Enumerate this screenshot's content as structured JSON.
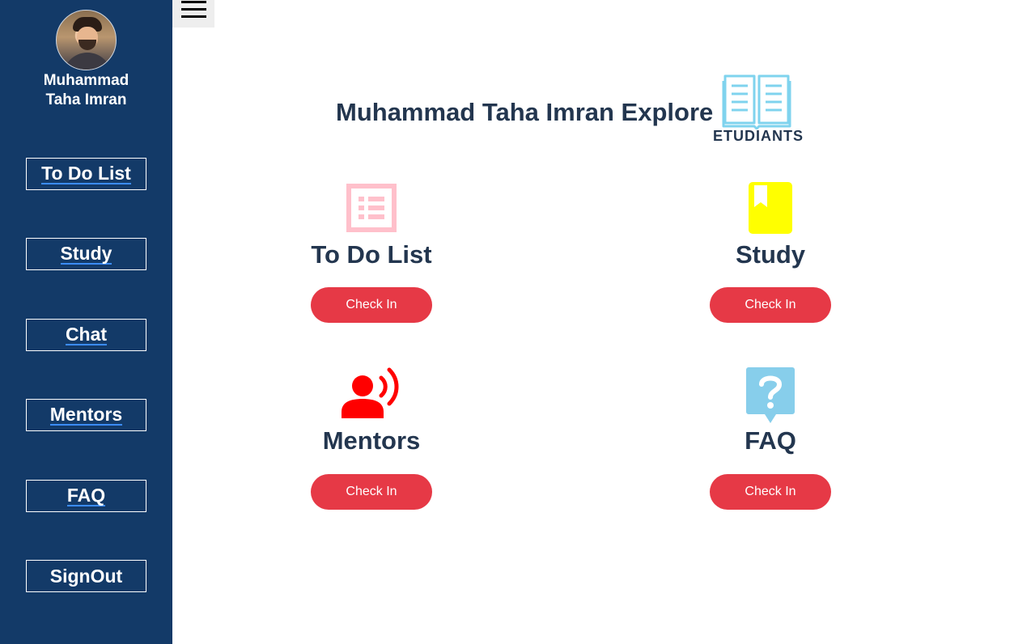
{
  "sidebar": {
    "user_name_line1": "Muhammad",
    "user_name_line2": "Taha Imran",
    "items": [
      {
        "label": "To Do List"
      },
      {
        "label": "Study"
      },
      {
        "label": "Chat"
      },
      {
        "label": "Mentors"
      },
      {
        "label": "FAQ"
      },
      {
        "label": "SignOut"
      }
    ]
  },
  "main": {
    "title": "Muhammad Taha Imran Explore",
    "logo_text": "ETUDIANTS",
    "cards": [
      {
        "title": "To Do List",
        "button": "Check In",
        "icon": "list-icon"
      },
      {
        "title": "Study",
        "button": "Check In",
        "icon": "book-icon"
      },
      {
        "title": "Mentors",
        "button": "Check In",
        "icon": "speaking-person-icon"
      },
      {
        "title": "FAQ",
        "button": "Check In",
        "icon": "question-bubble-icon"
      }
    ]
  },
  "colors": {
    "sidebar_bg": "#133a68",
    "heading": "#23364f",
    "button_bg": "#e63946",
    "list_icon": "#ffc0cb",
    "study_icon": "#ffff00",
    "mentors_icon": "#ff0000",
    "faq_icon": "#87ceeb"
  }
}
